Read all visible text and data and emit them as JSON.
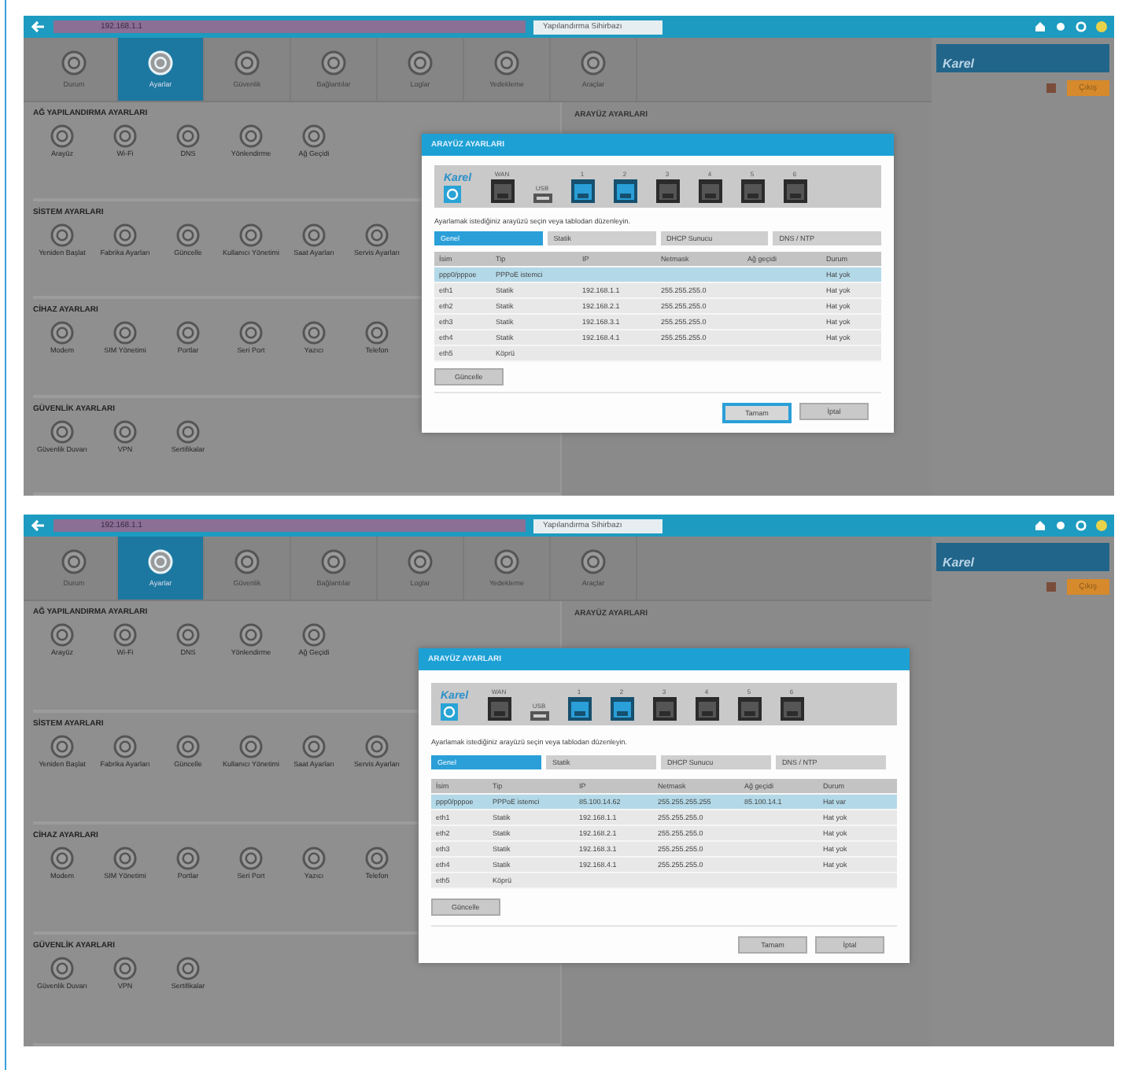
{
  "screenshots": [
    {
      "address": "192.168.1.1",
      "browser_tab": "Yapılandırma Sihirbazı",
      "toolbar": [
        {
          "label": "Durum",
          "selected": false
        },
        {
          "label": "Ayarlar",
          "selected": true
        },
        {
          "label": "Güvenlik",
          "selected": false
        },
        {
          "label": "Bağlantılar",
          "selected": false
        },
        {
          "label": "Loglar",
          "selected": false
        },
        {
          "label": "Yedekleme",
          "selected": false
        },
        {
          "label": "Araçlar",
          "selected": false
        }
      ],
      "sections": [
        {
          "title": "AĞ YAPILANDIRMA AYARLARI",
          "items": [
            "Arayüz",
            "Wi-Fi",
            "DNS",
            "Yönlendirme",
            "Ağ Geçidi"
          ]
        },
        {
          "title": "SİSTEM AYARLARI",
          "items": [
            "Yeniden Başlat",
            "Fabrika Ayarları",
            "Güncelle",
            "Kullanıcı Yönetimi",
            "Saat Ayarları",
            "Servis Ayarları"
          ]
        },
        {
          "title": "CİHAZ AYARLARI",
          "items": [
            "Modem",
            "SIM Yönetimi",
            "Portlar",
            "Seri Port",
            "Yazıcı",
            "Telefon"
          ]
        },
        {
          "title": "GÜVENLİK AYARLARI",
          "items": [
            "Güvenlik Duvarı",
            "VPN",
            "Sertifikalar"
          ]
        }
      ],
      "panel_title": "ARAYÜZ AYARLARI",
      "side": {
        "logo": "Karel",
        "button": "Çıkış"
      },
      "dialog": {
        "title": "ARAYÜZ AYARLARI",
        "logo": "Karel",
        "ports": [
          {
            "kind": "ethernet",
            "label": "WAN",
            "active": false
          },
          {
            "kind": "usb",
            "label": "USB"
          },
          {
            "kind": "ethernet",
            "label": "1",
            "active": true
          },
          {
            "kind": "ethernet",
            "label": "2",
            "active": true
          },
          {
            "kind": "ethernet",
            "label": "3",
            "active": false
          },
          {
            "kind": "ethernet",
            "label": "4",
            "active": false
          },
          {
            "kind": "ethernet",
            "label": "5",
            "active": false
          },
          {
            "kind": "ethernet",
            "label": "6",
            "active": false
          }
        ],
        "hint": "Ayarlamak istediğiniz arayüzü seçin veya tablodan düzenleyin.",
        "tabs": [
          {
            "label": "Genel",
            "selected": true
          },
          {
            "label": "Statik",
            "selected": false
          },
          {
            "label": "DHCP Sunucu",
            "selected": false
          },
          {
            "label": "DNS / NTP",
            "selected": false
          }
        ],
        "columns": [
          "İsim",
          "Tip",
          "IP",
          "Netmask",
          "Ağ geçidi",
          "Durum"
        ],
        "rows": [
          {
            "selected": true,
            "cells": [
              "ppp0/pppoe",
              "PPPoE istemci",
              null,
              null,
              null,
              "Hat yok"
            ]
          },
          {
            "selected": false,
            "cells": [
              "eth1",
              "Statik",
              "192.168.1.1",
              "255.255.255.0",
              null,
              "Hat yok"
            ]
          },
          {
            "selected": false,
            "cells": [
              "eth2",
              "Statik",
              "192.168.2.1",
              "255.255.255.0",
              null,
              "Hat yok"
            ]
          },
          {
            "selected": false,
            "cells": [
              "eth3",
              "Statik",
              "192.168.3.1",
              "255.255.255.0",
              null,
              "Hat yok"
            ]
          },
          {
            "selected": false,
            "cells": [
              "eth4",
              "Statik",
              "192.168.4.1",
              "255.255.255.0",
              null,
              "Hat yok"
            ]
          },
          {
            "selected": false,
            "cells": [
              "eth5",
              "Köprü",
              null,
              null,
              null,
              null
            ]
          }
        ],
        "update_button": "Güncelle",
        "buttons": [
          {
            "label": "Tamam",
            "focused": true
          },
          {
            "label": "İptal",
            "focused": false
          }
        ]
      }
    },
    {
      "address": "192.168.1.1",
      "browser_tab": "Yapılandırma Sihirbazı",
      "toolbar": [
        {
          "label": "Durum",
          "selected": false
        },
        {
          "label": "Ayarlar",
          "selected": true
        },
        {
          "label": "Güvenlik",
          "selected": false
        },
        {
          "label": "Bağlantılar",
          "selected": false
        },
        {
          "label": "Loglar",
          "selected": false
        },
        {
          "label": "Yedekleme",
          "selected": false
        },
        {
          "label": "Araçlar",
          "selected": false
        }
      ],
      "sections": [
        {
          "title": "AĞ YAPILANDIRMA AYARLARI",
          "items": [
            "Arayüz",
            "Wi-Fi",
            "DNS",
            "Yönlendirme",
            "Ağ Geçidi"
          ]
        },
        {
          "title": "SİSTEM AYARLARI",
          "items": [
            "Yeniden Başlat",
            "Fabrika Ayarları",
            "Güncelle",
            "Kullanıcı Yönetimi",
            "Saat Ayarları",
            "Servis Ayarları"
          ]
        },
        {
          "title": "CİHAZ AYARLARI",
          "items": [
            "Modem",
            "SIM Yönetimi",
            "Portlar",
            "Seri Port",
            "Yazıcı",
            "Telefon"
          ]
        },
        {
          "title": "GÜVENLİK AYARLARI",
          "items": [
            "Güvenlik Duvarı",
            "VPN",
            "Sertifikalar"
          ]
        }
      ],
      "panel_title": "ARAYÜZ AYARLARI",
      "side": {
        "logo": "Karel",
        "button": "Çıkış"
      },
      "dialog": {
        "title": "ARAYÜZ AYARLARI",
        "logo": "Karel",
        "ports": [
          {
            "kind": "ethernet",
            "label": "WAN",
            "active": false
          },
          {
            "kind": "usb",
            "label": "USB"
          },
          {
            "kind": "ethernet",
            "label": "1",
            "active": true
          },
          {
            "kind": "ethernet",
            "label": "2",
            "active": true
          },
          {
            "kind": "ethernet",
            "label": "3",
            "active": false
          },
          {
            "kind": "ethernet",
            "label": "4",
            "active": false
          },
          {
            "kind": "ethernet",
            "label": "5",
            "active": false
          },
          {
            "kind": "ethernet",
            "label": "6",
            "active": false
          }
        ],
        "hint": "Ayarlamak istediğiniz arayüzü seçin veya tablodan düzenleyin.",
        "tabs": [
          {
            "label": "Genel",
            "selected": true
          },
          {
            "label": "Statik",
            "selected": false
          },
          {
            "label": "DHCP Sunucu",
            "selected": false
          },
          {
            "label": "DNS / NTP",
            "selected": false
          }
        ],
        "columns": [
          "İsim",
          "Tip",
          "IP",
          "Netmask",
          "Ağ geçidi",
          "Durum"
        ],
        "rows": [
          {
            "selected": true,
            "cells": [
              "ppp0/pppoe",
              "PPPoE istemci",
              "85.100.14.62",
              "255.255.255.255",
              "85.100.14.1",
              "Hat var"
            ]
          },
          {
            "selected": false,
            "cells": [
              "eth1",
              "Statik",
              "192.168.1.1",
              "255.255.255.0",
              null,
              "Hat yok"
            ]
          },
          {
            "selected": false,
            "cells": [
              "eth2",
              "Statik",
              "192.168.2.1",
              "255.255.255.0",
              null,
              "Hat yok"
            ]
          },
          {
            "selected": false,
            "cells": [
              "eth3",
              "Statik",
              "192.168.3.1",
              "255.255.255.0",
              null,
              "Hat yok"
            ]
          },
          {
            "selected": false,
            "cells": [
              "eth4",
              "Statik",
              "192.168.4.1",
              "255.255.255.0",
              null,
              "Hat yok"
            ]
          },
          {
            "selected": false,
            "cells": [
              "eth5",
              "Köprü",
              null,
              null,
              null,
              null
            ]
          }
        ],
        "update_button": "Güncelle",
        "buttons": [
          {
            "label": "Tamam",
            "focused": false
          },
          {
            "label": "İptal",
            "focused": false
          }
        ]
      }
    }
  ]
}
